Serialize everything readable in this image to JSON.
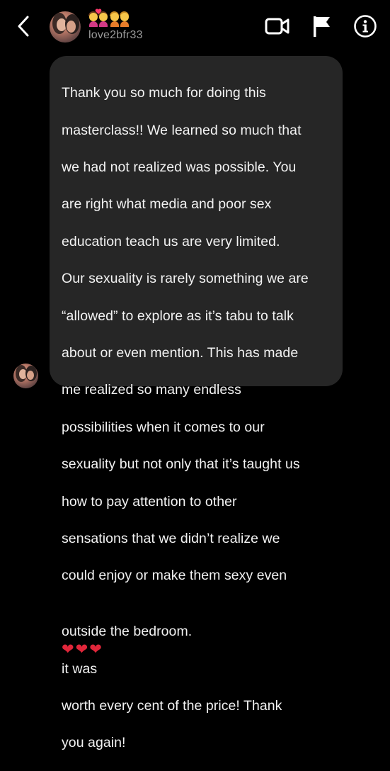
{
  "header": {
    "username": "love2bfr33",
    "title_emojis": [
      "couple-with-heart-emoji",
      "two-women-emoji"
    ]
  },
  "message": {
    "lines": [
      "Thank you so much for doing this",
      "masterclass!! We learned so much that",
      "we had not realized was possible.  You",
      "are right what media and poor sex",
      "education teach us are very limited.",
      "Our sexuality is rarely something we are",
      "“allowed” to explore as it’s tabu to talk",
      "about or even mention.  This has made",
      "me realized so many endless",
      "possibilities when it comes to our",
      "sexuality but not only that it’s taught us",
      "how to pay attention to other",
      "sensations that we didn’t realize we",
      "could enjoy or make them sexy even"
    ],
    "line15_before_hearts": "outside the bedroom.",
    "hearts": "❤❤❤",
    "line15_after_hearts": " it was",
    "tail_lines": [
      "worth every cent of the price! Thank",
      "you again!"
    ]
  },
  "colors": {
    "background": "#000000",
    "bubble": "#262626",
    "text": "#f2f2f2",
    "username": "#9a9a9a",
    "heart": "#e0263a"
  },
  "icons": {
    "back": "chevron-left-icon",
    "video": "video-call-icon",
    "flag": "flag-icon",
    "info": "info-icon"
  }
}
